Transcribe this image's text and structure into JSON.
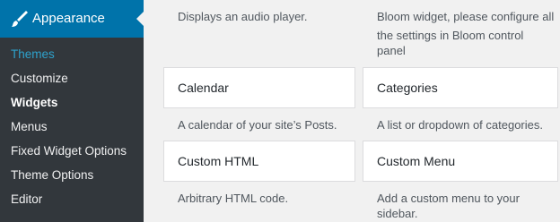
{
  "sidebar": {
    "menu_title": "Appearance",
    "items": [
      {
        "label": "Themes"
      },
      {
        "label": "Customize"
      },
      {
        "label": "Widgets"
      },
      {
        "label": "Menus"
      },
      {
        "label": "Fixed Widget Options"
      },
      {
        "label": "Theme Options"
      },
      {
        "label": "Editor"
      }
    ]
  },
  "widgets": {
    "audio_desc": "Displays an audio player.",
    "bloom_desc_line1": "Bloom widget, please configure all",
    "bloom_desc_line2": "the settings in Bloom control",
    "bloom_desc_line3": "panel",
    "calendar": {
      "title": "Calendar",
      "desc": "A calendar of your site’s Posts."
    },
    "categories": {
      "title": "Categories",
      "desc": "A list or dropdown of categories."
    },
    "custom_html": {
      "title": "Custom HTML",
      "desc": "Arbitrary HTML code."
    },
    "custom_menu": {
      "title": "Custom Menu",
      "desc_line1": "Add a custom menu to your",
      "desc_line2": "sidebar."
    }
  }
}
